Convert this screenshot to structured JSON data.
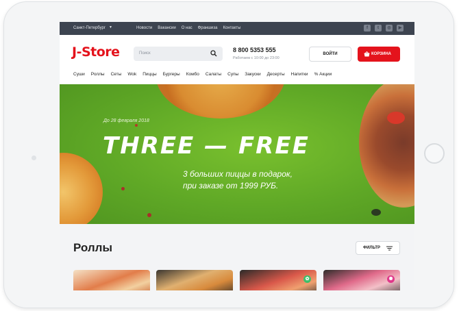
{
  "topbar": {
    "city": "Санкт-Петербург",
    "nav": [
      "Новости",
      "Вакансии",
      "О нас",
      "Франшиза",
      "Контакты"
    ],
    "social_icons": [
      "facebook-icon",
      "twitter-icon",
      "instagram-icon",
      "youtube-icon"
    ]
  },
  "header": {
    "logo": "J-Store",
    "search_placeholder": "Поиск",
    "phone": "8 800 5353 555",
    "hours": "Работаем с 10:00 до 23:00",
    "login_label": "ВОЙТИ",
    "cart_label": "КОРЗИНА"
  },
  "menu": [
    "Суши",
    "Роллы",
    "Сеты",
    "Wok",
    "Пиццы",
    "Бургеры",
    "Комбо",
    "Салаты",
    "Супы",
    "Закуски",
    "Десерты",
    "Напитки",
    "% Акции"
  ],
  "hero": {
    "date": "До 28 февраля 2018",
    "headline": "THREE — FREE",
    "sub_line1": "3 больших пиццы в подарок,",
    "sub_line2": "при заказе от 1999 РУБ."
  },
  "section": {
    "title": "Роллы",
    "filter_label": "ФИЛЬТР"
  },
  "colors": {
    "accent": "#e4131c",
    "topbar": "#3d4450",
    "hero_green": "#6bb52a"
  }
}
